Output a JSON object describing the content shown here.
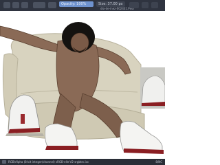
{
  "toolbar": {
    "opacity_label": "Opacity: 100%",
    "opacity_value": 1.0,
    "brush_size_label": "Size: 37.00 px",
    "file_title": "dio-de-inez-002431.PNG"
  },
  "status": {
    "left_text": "RGB/Alpha (8-bit integer/channel)  sRGB-elle-V2-srgbtrc.icc",
    "right_text": "8/NC"
  },
  "icons": {
    "toolbar_buttons": [
      "brush-preset-icon",
      "gradient-icon",
      "pattern-icon",
      "blend-mode-icon",
      "reset-icon"
    ],
    "right_buttons": [
      "mirror-icon",
      "wrap-icon",
      "lock-icon"
    ]
  },
  "colors": {
    "toolbar_bg": "#2f3440",
    "slider_fill": "#6f93cf",
    "couch": "#d8d3bf",
    "skin": "#8a6a56",
    "sneaker_trim": "#8a1e22"
  }
}
